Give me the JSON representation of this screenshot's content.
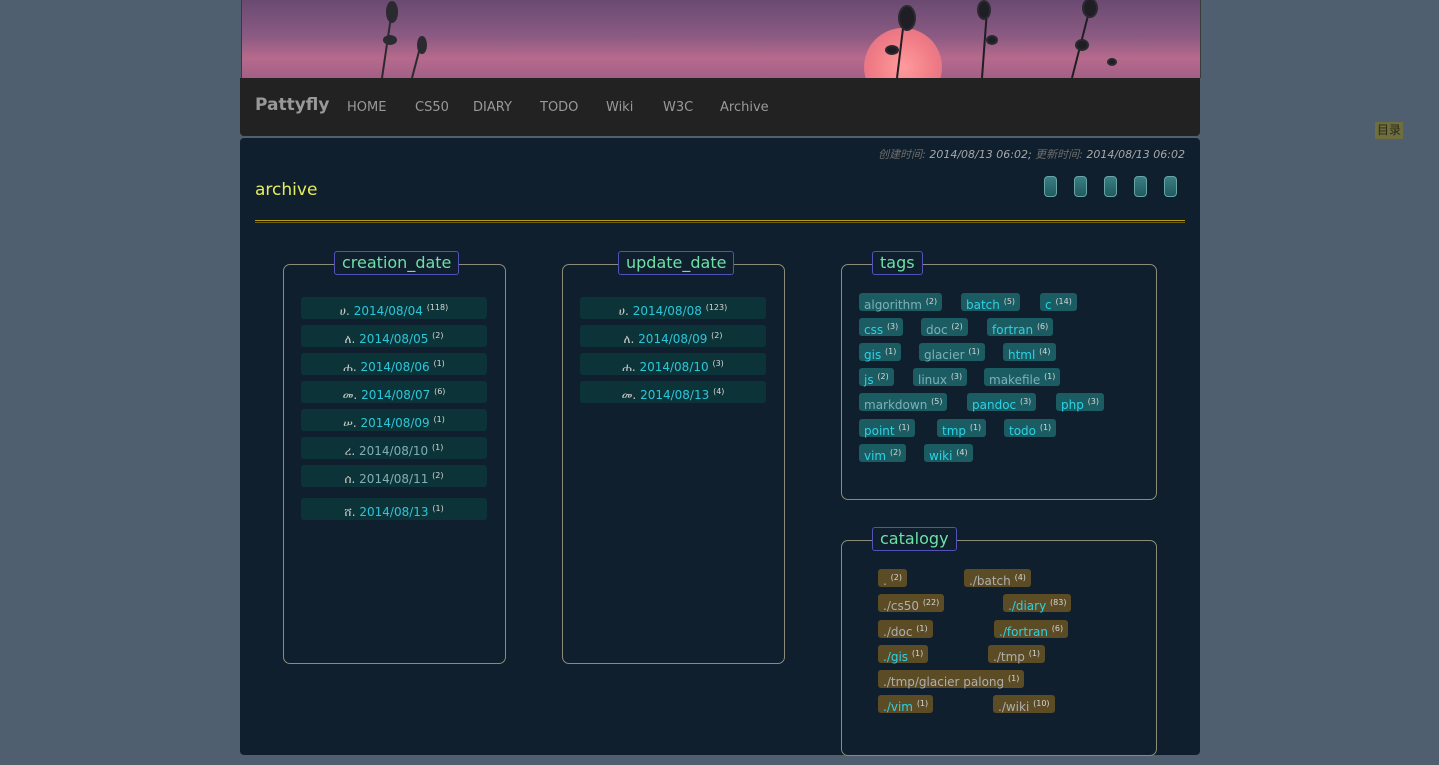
{
  "nav": {
    "brand": "Pattyfly",
    "items": [
      "HOME",
      "CS50",
      "DIARY",
      "TODO",
      "Wiki",
      "W3C",
      "Archive"
    ]
  },
  "meta": {
    "created_label": "创建时间:",
    "created": "2014/08/13 06:02;",
    "updated_label": "更新时间:",
    "updated": "2014/08/13 06:02"
  },
  "page_title": "archive",
  "toc_label": "目录",
  "creation_date": {
    "title": "creation_date",
    "rows": [
      {
        "prefix": "ሀ.",
        "date": "2014/08/04",
        "count": "(118)",
        "style": "active"
      },
      {
        "prefix": "ለ.",
        "date": "2014/08/05",
        "count": "(2)",
        "style": "active"
      },
      {
        "prefix": "ሐ.",
        "date": "2014/08/06",
        "count": "(1)",
        "style": "active"
      },
      {
        "prefix": "መ.",
        "date": "2014/08/07",
        "count": "(6)",
        "style": "active"
      },
      {
        "prefix": "ሠ.",
        "date": "2014/08/09",
        "count": "(1)",
        "style": "active"
      },
      {
        "prefix": "ረ.",
        "date": "2014/08/10",
        "count": "(1)",
        "style": "dim"
      },
      {
        "prefix": "ሰ.",
        "date": "2014/08/11",
        "count": "(2)",
        "style": "dim"
      },
      {
        "prefix": "ሸ.",
        "date": "2014/08/13",
        "count": "(1)",
        "style": "active"
      }
    ]
  },
  "update_date": {
    "title": "update_date",
    "rows": [
      {
        "prefix": "ሀ.",
        "date": "2014/08/08",
        "count": "(123)",
        "style": "active"
      },
      {
        "prefix": "ለ.",
        "date": "2014/08/09",
        "count": "(2)",
        "style": "active"
      },
      {
        "prefix": "ሐ.",
        "date": "2014/08/10",
        "count": "(3)",
        "style": "active"
      },
      {
        "prefix": "መ.",
        "date": "2014/08/13",
        "count": "(4)",
        "style": "active"
      }
    ]
  },
  "tags": {
    "title": "tags",
    "items": [
      {
        "name": "algorithm",
        "count": "(2)",
        "style": "dim"
      },
      {
        "name": "batch",
        "count": "(5)",
        "style": "active"
      },
      {
        "name": "c",
        "count": "(14)",
        "style": "active"
      },
      {
        "name": "css",
        "count": "(3)",
        "style": "active"
      },
      {
        "name": "doc",
        "count": "(2)",
        "style": "dim"
      },
      {
        "name": "fortran",
        "count": "(6)",
        "style": "active"
      },
      {
        "name": "gis",
        "count": "(1)",
        "style": "active"
      },
      {
        "name": "glacier",
        "count": "(1)",
        "style": "dim"
      },
      {
        "name": "html",
        "count": "(4)",
        "style": "active"
      },
      {
        "name": "js",
        "count": "(2)",
        "style": "active"
      },
      {
        "name": "linux",
        "count": "(3)",
        "style": "dim"
      },
      {
        "name": "makefile",
        "count": "(1)",
        "style": "dim"
      },
      {
        "name": "markdown",
        "count": "(5)",
        "style": "dim"
      },
      {
        "name": "pandoc",
        "count": "(3)",
        "style": "active"
      },
      {
        "name": "php",
        "count": "(3)",
        "style": "active"
      },
      {
        "name": "point",
        "count": "(1)",
        "style": "active"
      },
      {
        "name": "tmp",
        "count": "(1)",
        "style": "active"
      },
      {
        "name": "todo",
        "count": "(1)",
        "style": "active"
      },
      {
        "name": "vim",
        "count": "(2)",
        "style": "active"
      },
      {
        "name": "wiki",
        "count": "(4)",
        "style": "active"
      }
    ]
  },
  "catalogy": {
    "title": "catalogy",
    "items": [
      {
        "name": ".",
        "count": "(2)",
        "style": "dim"
      },
      {
        "name": "./batch",
        "count": "(4)",
        "style": "dim"
      },
      {
        "name": "./cs50",
        "count": "(22)",
        "style": "dim"
      },
      {
        "name": "./diary",
        "count": "(83)",
        "style": "active"
      },
      {
        "name": "./doc",
        "count": "(1)",
        "style": "dim"
      },
      {
        "name": "./fortran",
        "count": "(6)",
        "style": "active"
      },
      {
        "name": "./gis",
        "count": "(1)",
        "style": "active"
      },
      {
        "name": "./tmp",
        "count": "(1)",
        "style": "dim"
      },
      {
        "name": "./tmp/glacier palong",
        "count": "(1)",
        "style": "dim"
      },
      {
        "name": "./vim",
        "count": "(1)",
        "style": "active"
      },
      {
        "name": "./wiki",
        "count": "(10)",
        "style": "dim"
      }
    ]
  }
}
